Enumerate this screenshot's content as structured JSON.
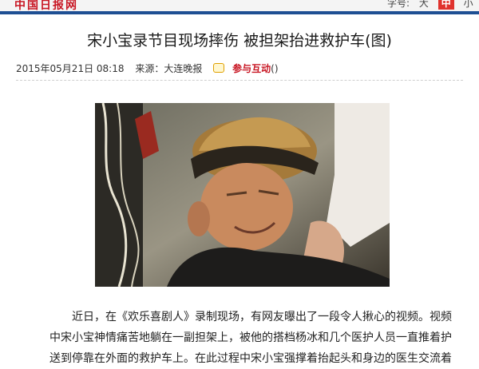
{
  "site": {
    "logo_text": "中国日报网",
    "accent": "#c81623",
    "rule_color": "#1e4f93"
  },
  "font_control": {
    "label": "字号:",
    "large": "大",
    "medium": "中",
    "small": "小"
  },
  "article": {
    "title": "宋小宝录节目现场摔伤 被担架抬进救护车(图)",
    "date": "2015年05月21日 08:18",
    "source": "来源：大连晚报",
    "comment_link": "参与互动",
    "comment_count": "()",
    "paragraph": "近日，在《欢乐喜剧人》录制现场，有网友曝出了一段令人揪心的视频。视频中宋小宝神情痛苦地躺在一副担架上，被他的搭档杨冰和几个医护人员一直推着护送到停靠在外面的救护车上。在此过程中宋小宝强撑着抬起头和身边的医生交流着"
  },
  "icons": {
    "comment": "speech-bubble-icon"
  }
}
